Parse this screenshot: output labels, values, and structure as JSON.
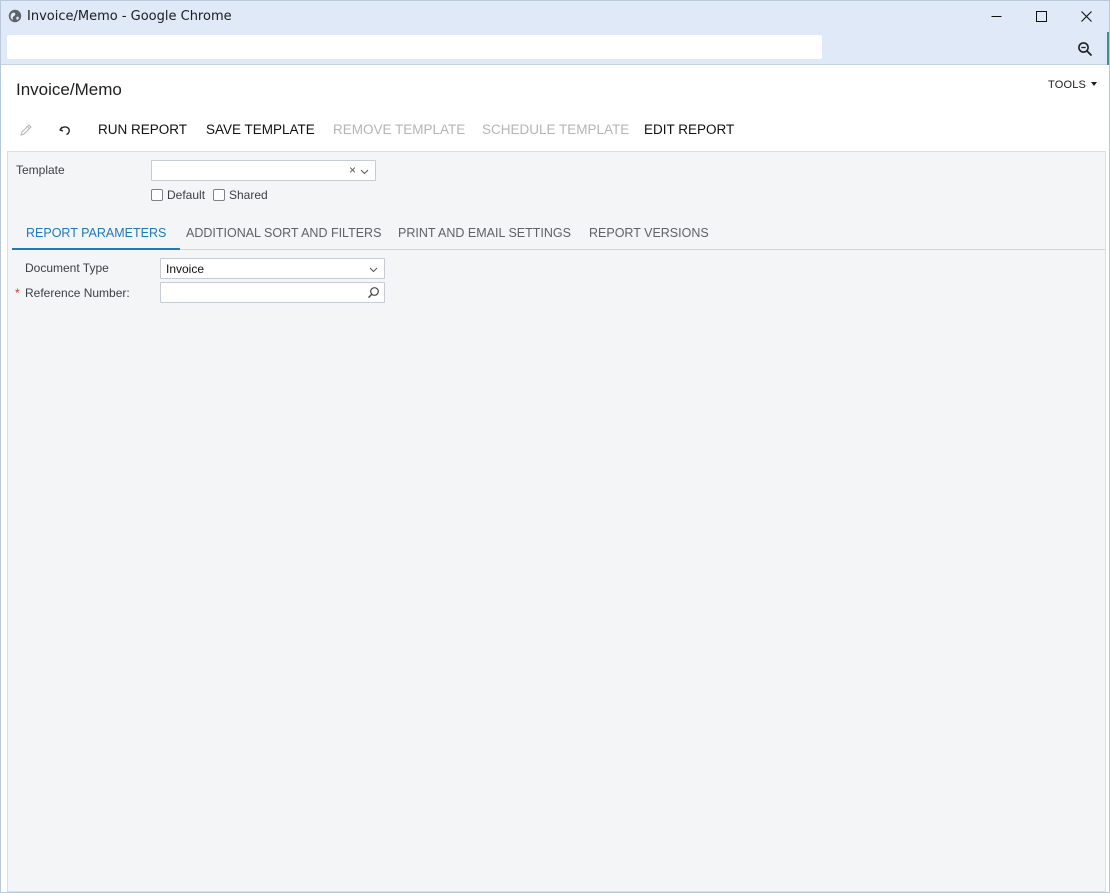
{
  "window": {
    "title": "Invoice/Memo - Google Chrome"
  },
  "page": {
    "title": "Invoice/Memo",
    "tools_label": "TOOLS"
  },
  "toolbar": {
    "run_report": "RUN REPORT",
    "save_template": "SAVE TEMPLATE",
    "remove_template": "REMOVE TEMPLATE",
    "schedule_template": "SCHEDULE TEMPLATE",
    "edit_report": "EDIT REPORT"
  },
  "template": {
    "label": "Template",
    "value": "",
    "clear_glyph": "×",
    "default_label": "Default",
    "shared_label": "Shared"
  },
  "tabs": [
    {
      "label": "REPORT PARAMETERS",
      "active": true
    },
    {
      "label": "ADDITIONAL SORT AND FILTERS",
      "active": false
    },
    {
      "label": "PRINT AND EMAIL SETTINGS",
      "active": false
    },
    {
      "label": "REPORT VERSIONS",
      "active": false
    }
  ],
  "parameters": {
    "document_type_label": "Document Type",
    "document_type_value": "Invoice",
    "required_marker": "*",
    "reference_number_label": "Reference Number:",
    "reference_number_value": ""
  },
  "colors": {
    "accent": "#2279b5",
    "titlebar": "#dfe9f7",
    "form_bg": "#f4f5f7",
    "required": "#d53a30"
  }
}
